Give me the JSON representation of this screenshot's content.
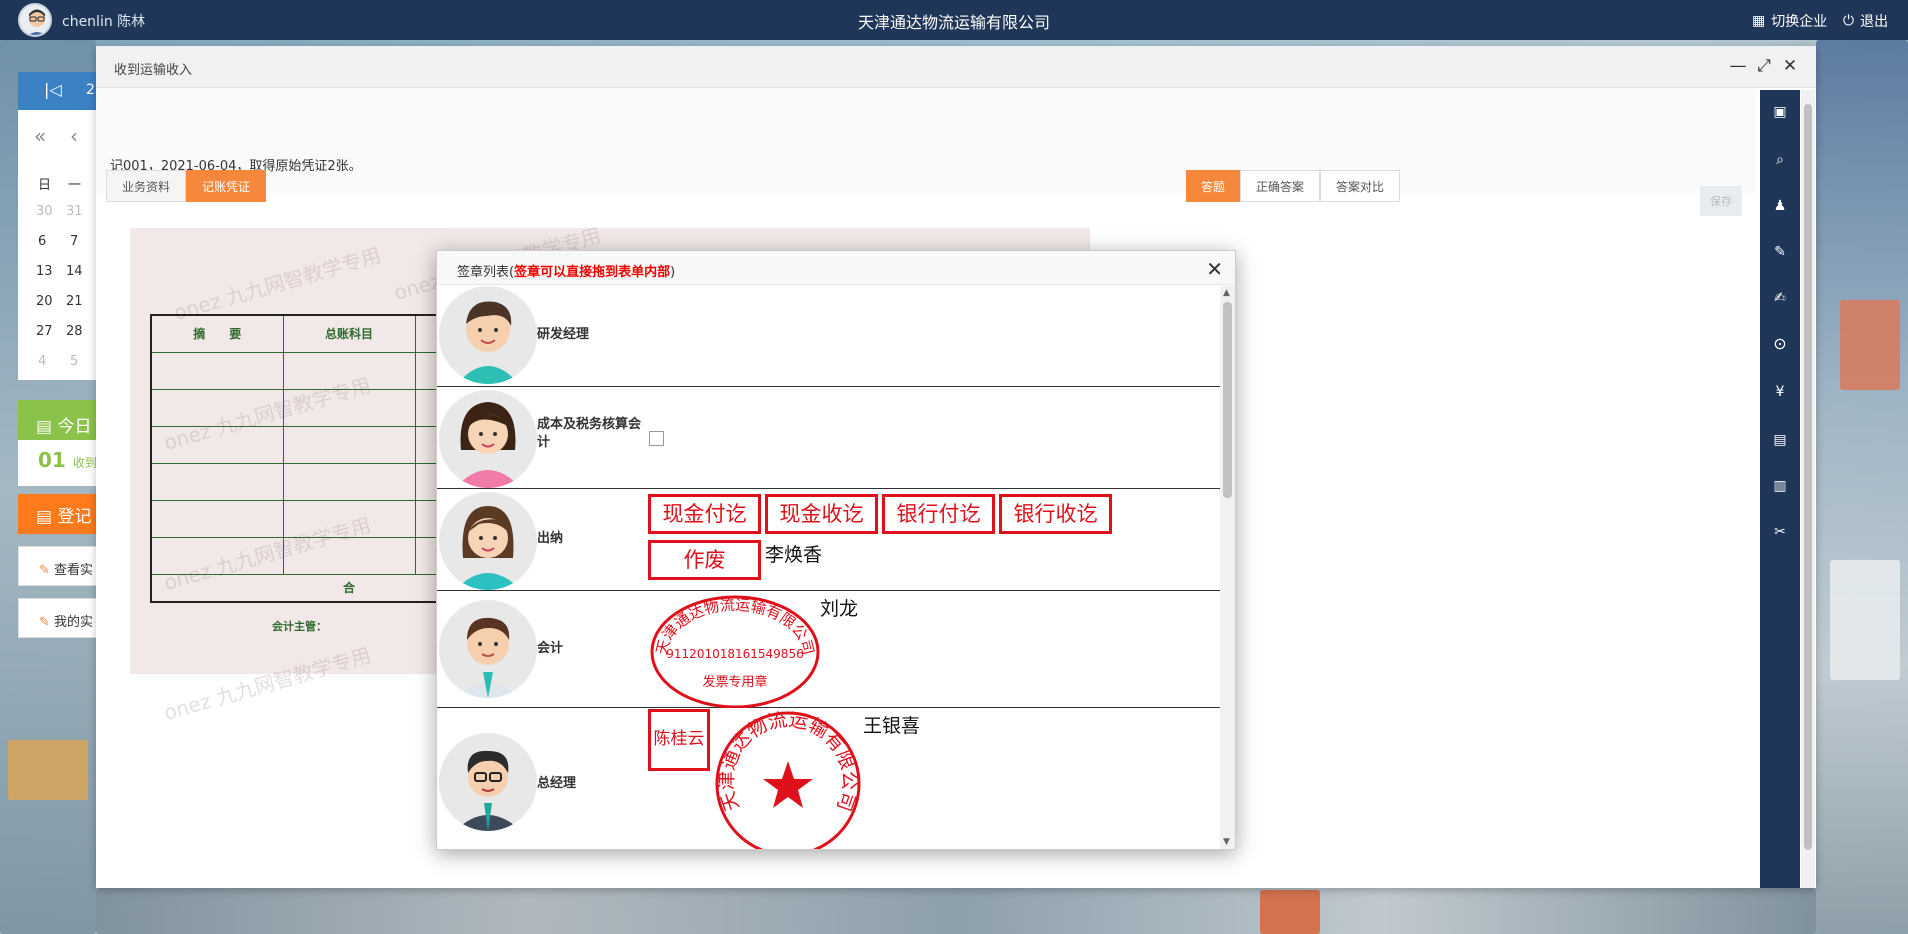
{
  "topbar": {
    "user": "chenlin 陈林",
    "company_title": "天津通达物流运输有限公司",
    "switch_label": "切换企业",
    "logout_label": "退出"
  },
  "left_panel": {
    "cal_header_fragment": "2",
    "weekday_sun": "日",
    "weekday_mon": "一",
    "days": [
      "30",
      "31",
      "6",
      "7",
      "13",
      "14",
      "20",
      "21",
      "27",
      "28",
      "4",
      "5"
    ],
    "today_label": "今日",
    "today_num": "01",
    "today_text": "收到",
    "register_label": "登记",
    "item1": "查看实",
    "item2": "我的实"
  },
  "window": {
    "title": "收到运输收入",
    "info": "记001，2021-06-04，取得原始凭证2张。",
    "tab_business": "业务资料",
    "tab_voucher": "记账凭证",
    "btn_answer": "答题",
    "btn_correct": "正确答案",
    "btn_compare": "答案对比",
    "btn_save": "保存"
  },
  "voucher": {
    "col_summary": "摘　　要",
    "col_account": "总账科目",
    "total_label": "合",
    "supervisor_label": "会计主管：",
    "watermark": "onez 九九网智教学专用"
  },
  "dialog": {
    "title_prefix": "签章列表(",
    "title_hint": "签章可以直接拖到表单内部",
    "title_suffix": ")",
    "rows": [
      {
        "role": "研发经理"
      },
      {
        "role": "成本及税务核算会计"
      },
      {
        "role": "出纳"
      },
      {
        "role": "会计"
      },
      {
        "role": "总经理"
      }
    ],
    "cashier_stamps": [
      "现金付讫",
      "现金收讫",
      "银行付讫",
      "银行收讫",
      "作废"
    ],
    "cashier_signature": "李焕香",
    "accountant_signature": "刘龙",
    "invoice_seal": {
      "company": "天津通达物流运输有限公司",
      "tax_id": "911201018161549856",
      "type": "发票专用章"
    },
    "gm_name_stamp": "陈桂云",
    "gm_signature": "王银喜",
    "company_seal": "天津通达物流运输有限公司"
  },
  "colors": {
    "topbar": "#1f3659",
    "accent_orange": "#f5883a",
    "stamp_red": "#e0101b",
    "hint_red": "#ee0000"
  }
}
